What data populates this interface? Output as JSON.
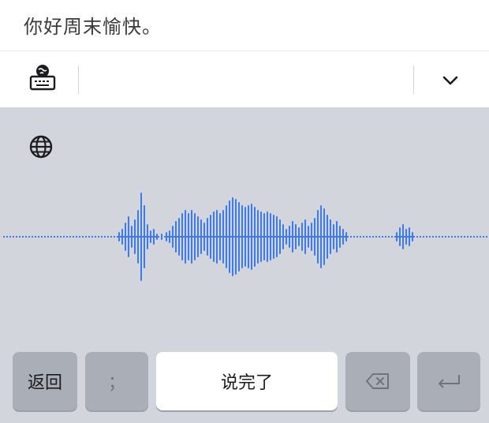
{
  "input": {
    "text": "你好周末愉快。"
  },
  "toolbar": {
    "keyboard_icon": "keyboard-globe-icon",
    "collapse_icon": "chevron-down-icon"
  },
  "voice": {
    "language_icon": "globe-icon",
    "accent": "#3d7bea",
    "panel_bg": "#d2d5dc"
  },
  "keys": {
    "back_label": "返回",
    "punct_label": "；",
    "done_label": "说完了",
    "delete_icon": "backspace-icon",
    "enter_icon": "return-icon"
  }
}
